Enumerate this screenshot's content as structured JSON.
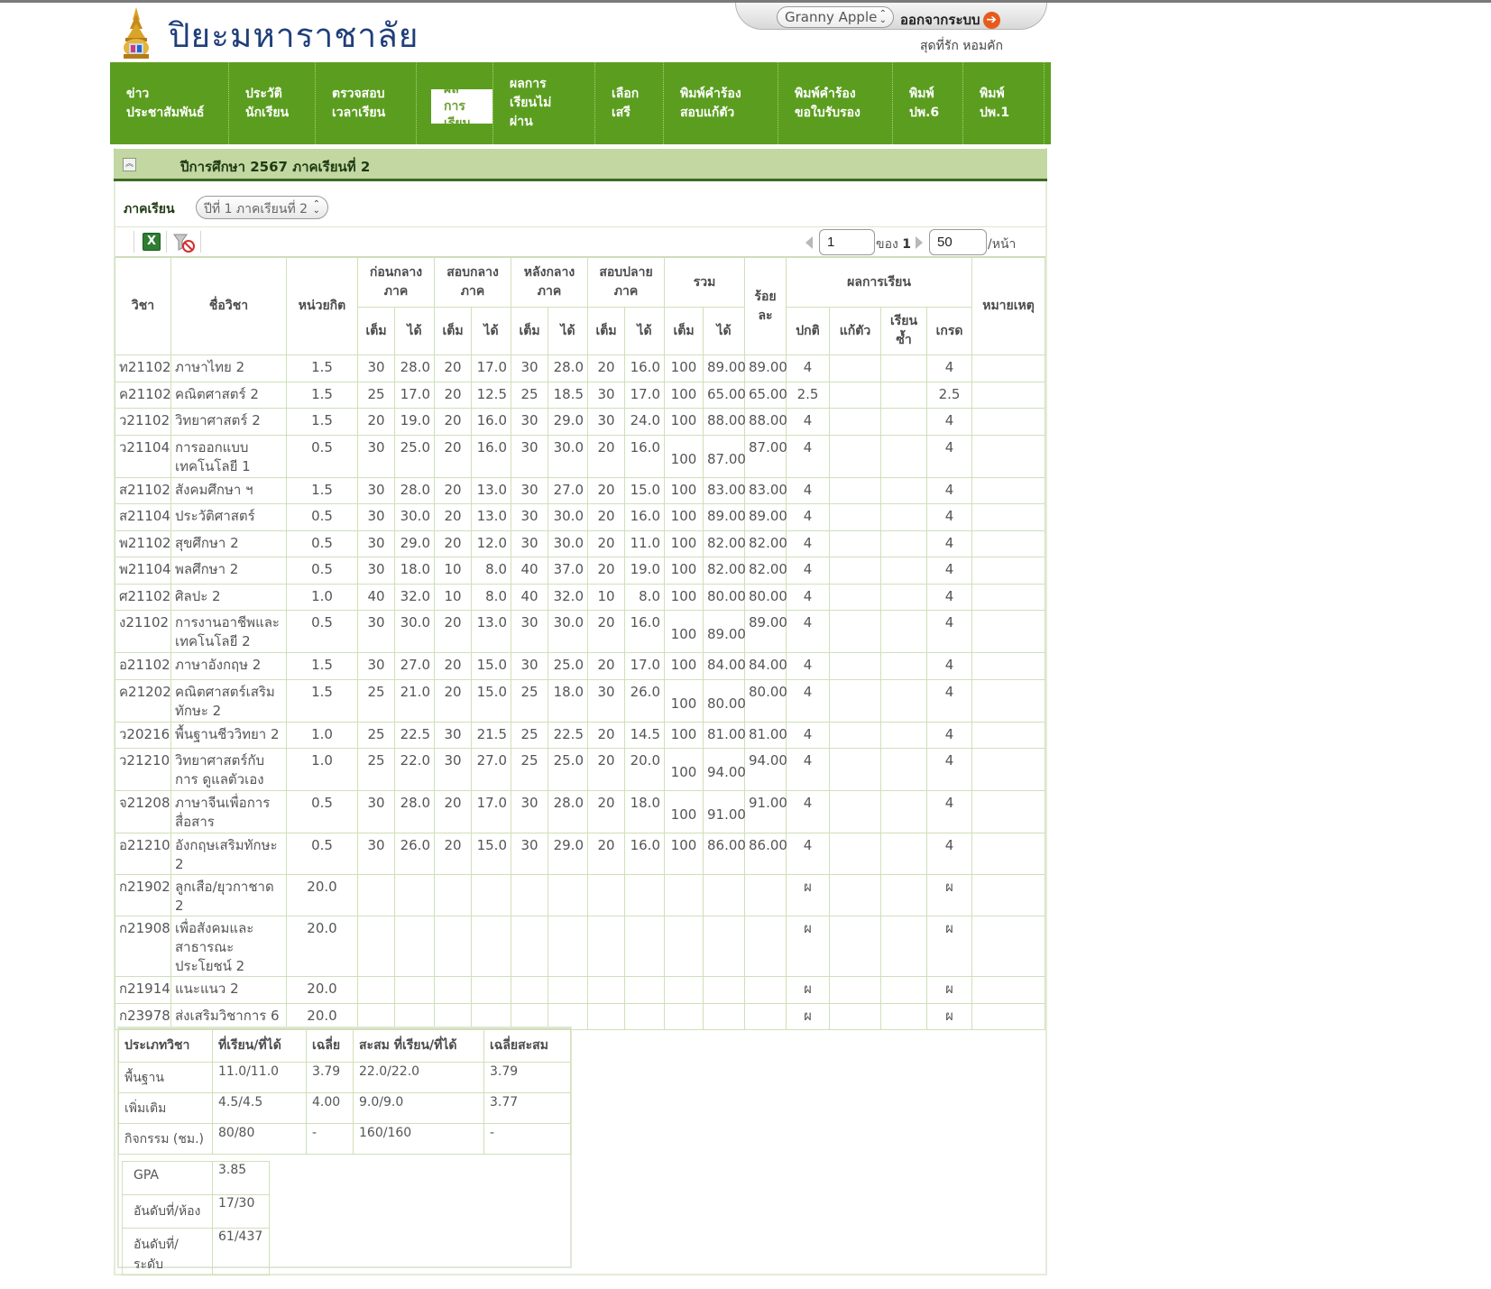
{
  "header": {
    "site_title": "ปิยะมหาราชาลัย",
    "user_select_value": "Granny Apple",
    "logout_label": "ออกจากระบบ",
    "user_name": "สุดที่รัก หอมคัก"
  },
  "nav": {
    "items": [
      {
        "label": "ข่าว\nประชาสัมพันธ์"
      },
      {
        "label": "ประวัติ\nนักเรียน"
      },
      {
        "label": "ตรวจสอบ\nเวลาเรียน"
      },
      {
        "label": "ผล\nการ\nเรียน"
      },
      {
        "label": "ผลการ\nเรียนไม่\nผ่าน"
      },
      {
        "label": "เลือก\nเสรี"
      },
      {
        "label": "พิมพ์คำร้อง\nสอบแก้ตัว"
      },
      {
        "label": "พิมพ์คำร้อง\nขอใบรับรอง"
      },
      {
        "label": "พิมพ์\nปพ.6"
      },
      {
        "label": "พิมพ์\nปพ.1"
      }
    ]
  },
  "panel": {
    "title": "ปีการศึกษา 2567 ภาคเรียนที่ 2",
    "term_label": "ภาคเรียน",
    "term_value": "ปีที่ 1 ภาคเรียนที่ 2"
  },
  "pager": {
    "page": "1",
    "of_label": "ของ",
    "total_pages": "1",
    "per_page": "50",
    "per_page_suffix": "/หน้า"
  },
  "table": {
    "h_subject_code": "วิชา",
    "h_subject_name": "ชื่อวิชา",
    "h_credits": "หน่วยกิต",
    "h_pre_mid": "ก่อนกลาง\nภาค",
    "h_midterm": "สอบกลาง\nภาค",
    "h_post_mid": "หลังกลาง\nภาค",
    "h_final": "สอบปลาย\nภาค",
    "h_total": "รวม",
    "h_percent": "ร้อย\nละ",
    "h_result": "ผลการเรียน",
    "h_remark": "หมายเหตุ",
    "h_full": "เต็ม",
    "h_got": "ได้",
    "h_normal": "ปกติ",
    "h_remedial": "แก้ตัว",
    "h_repeat": "เรียน\nซ้ำ",
    "h_grade": "เกรด",
    "rows": [
      {
        "code": "ท21102",
        "name": "ภาษาไทย 2",
        "credit": "1.5",
        "f1": "30",
        "g1": "28.0",
        "f2": "20",
        "g2": "17.0",
        "f3": "30",
        "g3": "28.0",
        "f4": "20",
        "g4": "16.0",
        "ft": "100",
        "gt": "89.00",
        "pct": "89.00",
        "normal": "4",
        "remedial": "",
        "repeat": "",
        "grade": "4",
        "remark": ""
      },
      {
        "code": "ค21102",
        "name": "คณิตศาสตร์ 2",
        "credit": "1.5",
        "f1": "25",
        "g1": "17.0",
        "f2": "20",
        "g2": "12.5",
        "f3": "25",
        "g3": "18.5",
        "f4": "30",
        "g4": "17.0",
        "ft": "100",
        "gt": "65.00",
        "pct": "65.00",
        "normal": "2.5",
        "remedial": "",
        "repeat": "",
        "grade": "2.5",
        "remark": ""
      },
      {
        "code": "ว21102",
        "name": "วิทยาศาสตร์ 2",
        "credit": "1.5",
        "f1": "20",
        "g1": "19.0",
        "f2": "20",
        "g2": "16.0",
        "f3": "30",
        "g3": "29.0",
        "f4": "30",
        "g4": "24.0",
        "ft": "100",
        "gt": "88.00",
        "pct": "88.00",
        "normal": "4",
        "remedial": "",
        "repeat": "",
        "grade": "4",
        "remark": ""
      },
      {
        "code": "ว21104",
        "name": "การออกแบบ เทคโนโลยี 1",
        "credit": "0.5",
        "f1": "30",
        "g1": "25.0",
        "f2": "20",
        "g2": "16.0",
        "f3": "30",
        "g3": "30.0",
        "f4": "20",
        "g4": "16.0",
        "ft": "100",
        "gt": "87.00",
        "pct": "87.00",
        "normal": "4",
        "remedial": "",
        "repeat": "",
        "grade": "4",
        "remark": "",
        "tall": true
      },
      {
        "code": "ส21102",
        "name": "สังคมศึกษา ฯ",
        "credit": "1.5",
        "f1": "30",
        "g1": "28.0",
        "f2": "20",
        "g2": "13.0",
        "f3": "30",
        "g3": "27.0",
        "f4": "20",
        "g4": "15.0",
        "ft": "100",
        "gt": "83.00",
        "pct": "83.00",
        "normal": "4",
        "remedial": "",
        "repeat": "",
        "grade": "4",
        "remark": ""
      },
      {
        "code": "ส21104",
        "name": "ประวัติศาสตร์",
        "credit": "0.5",
        "f1": "30",
        "g1": "30.0",
        "f2": "20",
        "g2": "13.0",
        "f3": "30",
        "g3": "30.0",
        "f4": "20",
        "g4": "16.0",
        "ft": "100",
        "gt": "89.00",
        "pct": "89.00",
        "normal": "4",
        "remedial": "",
        "repeat": "",
        "grade": "4",
        "remark": ""
      },
      {
        "code": "พ21102",
        "name": "สุขศึกษา 2",
        "credit": "0.5",
        "f1": "30",
        "g1": "29.0",
        "f2": "20",
        "g2": "12.0",
        "f3": "30",
        "g3": "30.0",
        "f4": "20",
        "g4": "11.0",
        "ft": "100",
        "gt": "82.00",
        "pct": "82.00",
        "normal": "4",
        "remedial": "",
        "repeat": "",
        "grade": "4",
        "remark": ""
      },
      {
        "code": "พ21104",
        "name": "พลศึกษา 2",
        "credit": "0.5",
        "f1": "30",
        "g1": "18.0",
        "f2": "10",
        "g2": "8.0",
        "f3": "40",
        "g3": "37.0",
        "f4": "20",
        "g4": "19.0",
        "ft": "100",
        "gt": "82.00",
        "pct": "82.00",
        "normal": "4",
        "remedial": "",
        "repeat": "",
        "grade": "4",
        "remark": ""
      },
      {
        "code": "ศ21102",
        "name": "ศิลปะ 2",
        "credit": "1.0",
        "f1": "40",
        "g1": "32.0",
        "f2": "10",
        "g2": "8.0",
        "f3": "40",
        "g3": "32.0",
        "f4": "10",
        "g4": "8.0",
        "ft": "100",
        "gt": "80.00",
        "pct": "80.00",
        "normal": "4",
        "remedial": "",
        "repeat": "",
        "grade": "4",
        "remark": ""
      },
      {
        "code": "ง21102",
        "name": "การงานอาชีพและ เทคโนโลยี 2",
        "credit": "0.5",
        "f1": "30",
        "g1": "30.0",
        "f2": "20",
        "g2": "13.0",
        "f3": "30",
        "g3": "30.0",
        "f4": "20",
        "g4": "16.0",
        "ft": "100",
        "gt": "89.00",
        "pct": "89.00",
        "normal": "4",
        "remedial": "",
        "repeat": "",
        "grade": "4",
        "remark": "",
        "tall": true
      },
      {
        "code": "อ21102",
        "name": "ภาษาอังกฤษ 2",
        "credit": "1.5",
        "f1": "30",
        "g1": "27.0",
        "f2": "20",
        "g2": "15.0",
        "f3": "30",
        "g3": "25.0",
        "f4": "20",
        "g4": "17.0",
        "ft": "100",
        "gt": "84.00",
        "pct": "84.00",
        "normal": "4",
        "remedial": "",
        "repeat": "",
        "grade": "4",
        "remark": ""
      },
      {
        "code": "ค21202",
        "name": "คณิตศาสตร์เสริม ทักษะ 2",
        "credit": "1.5",
        "f1": "25",
        "g1": "21.0",
        "f2": "20",
        "g2": "15.0",
        "f3": "25",
        "g3": "18.0",
        "f4": "30",
        "g4": "26.0",
        "ft": "100",
        "gt": "80.00",
        "pct": "80.00",
        "normal": "4",
        "remedial": "",
        "repeat": "",
        "grade": "4",
        "remark": "",
        "tall": true
      },
      {
        "code": "ว20216",
        "name": "พื้นฐานชีววิทยา 2",
        "credit": "1.0",
        "f1": "25",
        "g1": "22.5",
        "f2": "30",
        "g2": "21.5",
        "f3": "25",
        "g3": "22.5",
        "f4": "20",
        "g4": "14.5",
        "ft": "100",
        "gt": "81.00",
        "pct": "81.00",
        "normal": "4",
        "remedial": "",
        "repeat": "",
        "grade": "4",
        "remark": ""
      },
      {
        "code": "ว21210",
        "name": "วิทยาศาสตร์กับการ ดูแลตัวเอง",
        "credit": "1.0",
        "f1": "25",
        "g1": "22.0",
        "f2": "30",
        "g2": "27.0",
        "f3": "25",
        "g3": "25.0",
        "f4": "20",
        "g4": "20.0",
        "ft": "100",
        "gt": "94.00",
        "pct": "94.00",
        "normal": "4",
        "remedial": "",
        "repeat": "",
        "grade": "4",
        "remark": "",
        "tall": true
      },
      {
        "code": "จ21208",
        "name": "ภาษาจีนเพื่อการ สื่อสาร",
        "credit": "0.5",
        "f1": "30",
        "g1": "28.0",
        "f2": "20",
        "g2": "17.0",
        "f3": "30",
        "g3": "28.0",
        "f4": "20",
        "g4": "18.0",
        "ft": "100",
        "gt": "91.00",
        "pct": "91.00",
        "normal": "4",
        "remedial": "",
        "repeat": "",
        "grade": "4",
        "remark": "",
        "tall": true
      },
      {
        "code": "อ21210",
        "name": "อังกฤษเสริมทักษะ 2",
        "credit": "0.5",
        "f1": "30",
        "g1": "26.0",
        "f2": "20",
        "g2": "15.0",
        "f3": "30",
        "g3": "29.0",
        "f4": "20",
        "g4": "16.0",
        "ft": "100",
        "gt": "86.00",
        "pct": "86.00",
        "normal": "4",
        "remedial": "",
        "repeat": "",
        "grade": "4",
        "remark": ""
      },
      {
        "code": "ก21902",
        "name": "ลูกเสือ/ยุวกาชาด 2",
        "credit": "20.0",
        "f1": "",
        "g1": "",
        "f2": "",
        "g2": "",
        "f3": "",
        "g3": "",
        "f4": "",
        "g4": "",
        "ft": "",
        "gt": "",
        "pct": "",
        "normal": "ผ",
        "remedial": "",
        "repeat": "",
        "grade": "ผ",
        "remark": ""
      },
      {
        "code": "ก21908",
        "name": "เพื่อสังคมและ สาธารณะประโยชน์ 2",
        "credit": "20.0",
        "f1": "",
        "g1": "",
        "f2": "",
        "g2": "",
        "f3": "",
        "g3": "",
        "f4": "",
        "g4": "",
        "ft": "",
        "gt": "",
        "pct": "",
        "normal": "ผ",
        "remedial": "",
        "repeat": "",
        "grade": "ผ",
        "remark": "",
        "tall3": true
      },
      {
        "code": "ก21914",
        "name": "แนะแนว 2",
        "credit": "20.0",
        "f1": "",
        "g1": "",
        "f2": "",
        "g2": "",
        "f3": "",
        "g3": "",
        "f4": "",
        "g4": "",
        "ft": "",
        "gt": "",
        "pct": "",
        "normal": "ผ",
        "remedial": "",
        "repeat": "",
        "grade": "ผ",
        "remark": ""
      },
      {
        "code": "ก23978",
        "name": "ส่งเสริมวิชาการ 6",
        "credit": "20.0",
        "f1": "",
        "g1": "",
        "f2": "",
        "g2": "",
        "f3": "",
        "g3": "",
        "f4": "",
        "g4": "",
        "ft": "",
        "gt": "",
        "pct": "",
        "normal": "ผ",
        "remedial": "",
        "repeat": "",
        "grade": "ผ",
        "remark": ""
      }
    ]
  },
  "summary": {
    "headers": [
      "ประเภทวิชา",
      "ที่เรียน/ที่ได้",
      "เฉลี่ย",
      "สะสม ที่เรียน/ที่ได้",
      "เฉลี่ยสะสม"
    ],
    "rows": [
      [
        "พื้นฐาน",
        "11.0/11.0",
        "3.79",
        "22.0/22.0",
        "3.79"
      ],
      [
        "เพิ่มเติม",
        "4.5/4.5",
        "4.00",
        "9.0/9.0",
        "3.77"
      ],
      [
        "กิจกรรม (ชม.)",
        "80/80",
        "-",
        "160/160",
        "-"
      ]
    ]
  },
  "gpa": {
    "rows": [
      [
        "GPA",
        "3.85"
      ],
      [
        "อันดับที่/ห้อง",
        "17/30"
      ],
      [
        "อันดับที่/ระดับ",
        "61/437"
      ]
    ]
  },
  "colors": {
    "nav_green": "#5b9e1f",
    "panel_head": "#c2d7a2",
    "title_blue": "#1f3f7a",
    "logout_orange": "#e85a1c"
  }
}
